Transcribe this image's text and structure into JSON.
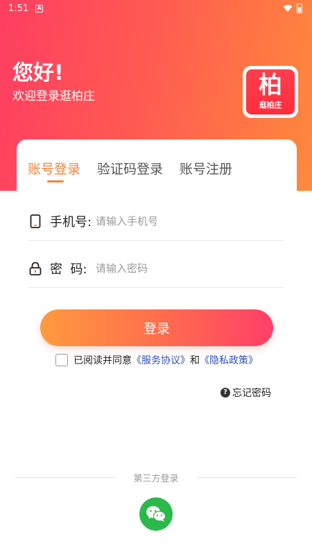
{
  "status_bar": {
    "time": "1:51",
    "notification_letter": "A"
  },
  "header": {
    "greeting": "您好!",
    "welcome": "欢迎登录逛柏庄"
  },
  "logo": {
    "char": "柏",
    "sub": "逛柏庄"
  },
  "tabs": [
    {
      "label": "账号登录",
      "active": true
    },
    {
      "label": "验证码登录",
      "active": false
    },
    {
      "label": "账号注册",
      "active": false
    }
  ],
  "form": {
    "phone_label": "手机号:",
    "phone_placeholder": "请输入手机号",
    "password_label": "密  码:",
    "password_placeholder": "请输入密码",
    "login_label": "登录"
  },
  "agreement": {
    "prefix": "已阅读并同意",
    "service": "《服务协议》",
    "and": "和",
    "privacy": "《隐私政策》"
  },
  "forgot_password": "忘记密码",
  "third_party": {
    "label": "第三方登录"
  },
  "colors": {
    "accent": "#f0843b",
    "link": "#2f4fb5",
    "wechat": "#2bb94c",
    "gradient_start": "#ff3e62",
    "gradient_end": "#ff8a3c"
  }
}
